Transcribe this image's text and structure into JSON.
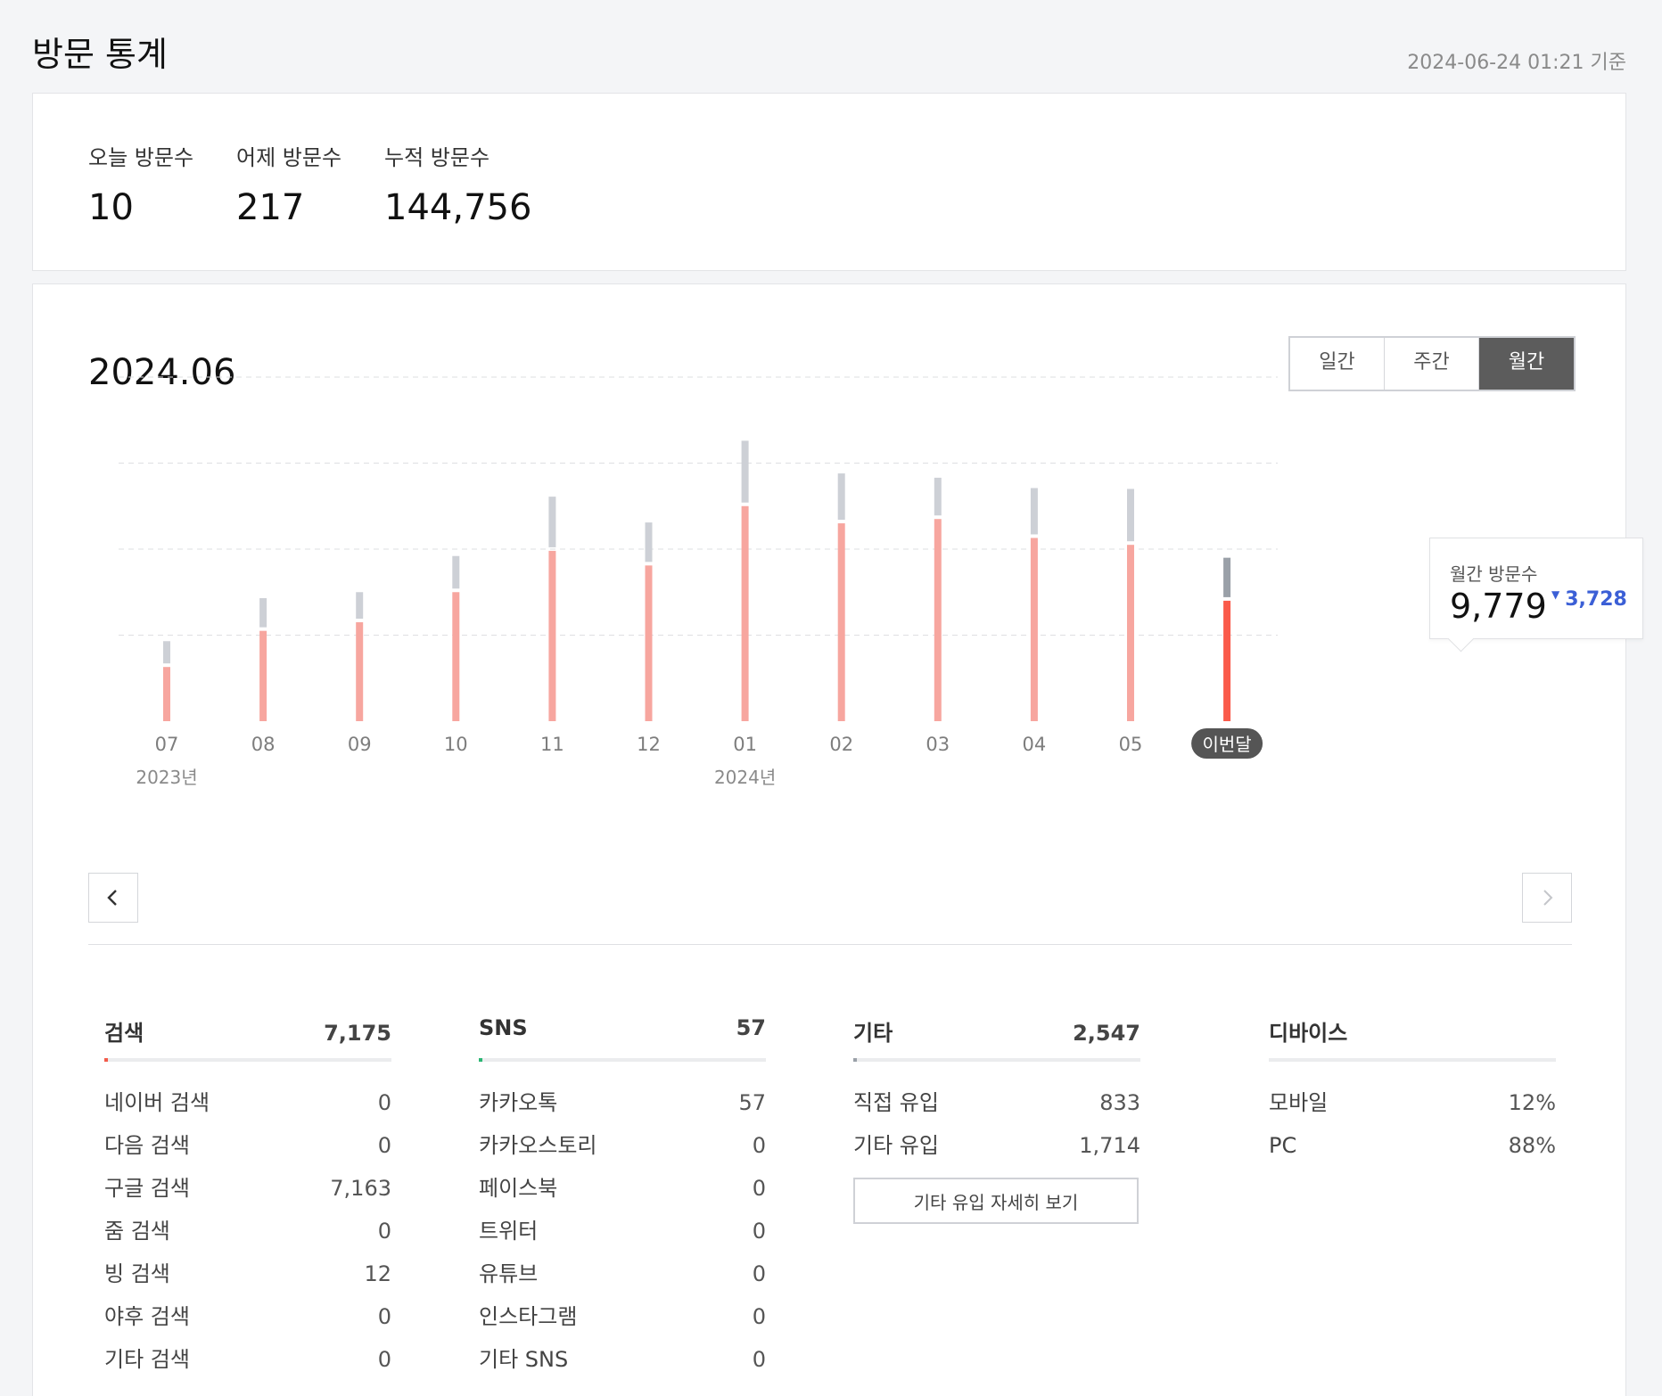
{
  "header": {
    "title": "방문 통계",
    "updated": "2024-06-24 01:21 기준"
  },
  "summary": [
    {
      "label": "오늘 방문수",
      "value": "10"
    },
    {
      "label": "어제 방문수",
      "value": "217"
    },
    {
      "label": "누적 방문수",
      "value": "144,756"
    }
  ],
  "period": "2024.06",
  "range_tabs": [
    "일간",
    "주간",
    "월간"
  ],
  "active_tab": "월간",
  "chart_data": {
    "type": "bar",
    "categories": [
      "07",
      "08",
      "09",
      "10",
      "11",
      "12",
      "01",
      "02",
      "03",
      "04",
      "05",
      "이번달"
    ],
    "year_labels": [
      {
        "at": "07",
        "label": "2023년"
      },
      {
        "at": "01",
        "label": "2024년"
      }
    ],
    "series": [
      {
        "values": [
          6300,
          10500,
          11500,
          15000,
          19800,
          18100,
          25000,
          23000,
          23500,
          21300,
          20500,
          14000
        ]
      },
      {
        "values": [
          3000,
          3800,
          3500,
          4200,
          6300,
          5000,
          7600,
          5800,
          4800,
          5800,
          6500,
          5000
        ]
      }
    ],
    "stacked": true,
    "ylim": [
      0,
      40000
    ],
    "grid": true,
    "highlight_index": 11,
    "colors": {
      "primary": "#f7a69f",
      "secondary": "#cdd0d6",
      "highlight_primary": "#fa5a4a",
      "highlight_secondary": "#9aa0a8"
    }
  },
  "tooltip": {
    "label": "월간 방문수",
    "value": "9,779",
    "change": "3,728"
  },
  "sections": [
    {
      "title": "검색",
      "total": "7,175",
      "bar_color": "#f25b4a",
      "bar_fill": 0.01,
      "rows": [
        {
          "label": "네이버 검색",
          "value": "0"
        },
        {
          "label": "다음 검색",
          "value": "0"
        },
        {
          "label": "구글 검색",
          "value": "7,163"
        },
        {
          "label": "줌 검색",
          "value": "0"
        },
        {
          "label": "빙 검색",
          "value": "12"
        },
        {
          "label": "야후 검색",
          "value": "0"
        },
        {
          "label": "기타 검색",
          "value": "0"
        }
      ]
    },
    {
      "title": "SNS",
      "total": "57",
      "bar_color": "#2bb673",
      "bar_fill": 0.01,
      "rows": [
        {
          "label": "카카오톡",
          "value": "57"
        },
        {
          "label": "카카오스토리",
          "value": "0"
        },
        {
          "label": "페이스북",
          "value": "0"
        },
        {
          "label": "트위터",
          "value": "0"
        },
        {
          "label": "유튜브",
          "value": "0"
        },
        {
          "label": "인스타그램",
          "value": "0"
        },
        {
          "label": "기타 SNS",
          "value": "0"
        }
      ]
    },
    {
      "title": "기타",
      "total": "2,547",
      "bar_color": "#9aa0a8",
      "bar_fill": 0.01,
      "rows": [
        {
          "label": "직접 유입",
          "value": "833"
        },
        {
          "label": "기타 유입",
          "value": "1,714"
        }
      ],
      "button": "기타 유입 자세히 보기"
    },
    {
      "title": "디바이스",
      "total": "",
      "bar_color": "#ebecee",
      "bar_fill": 0,
      "rows": [
        {
          "label": "모바일",
          "value": "12%"
        },
        {
          "label": "PC",
          "value": "88%"
        }
      ]
    }
  ]
}
